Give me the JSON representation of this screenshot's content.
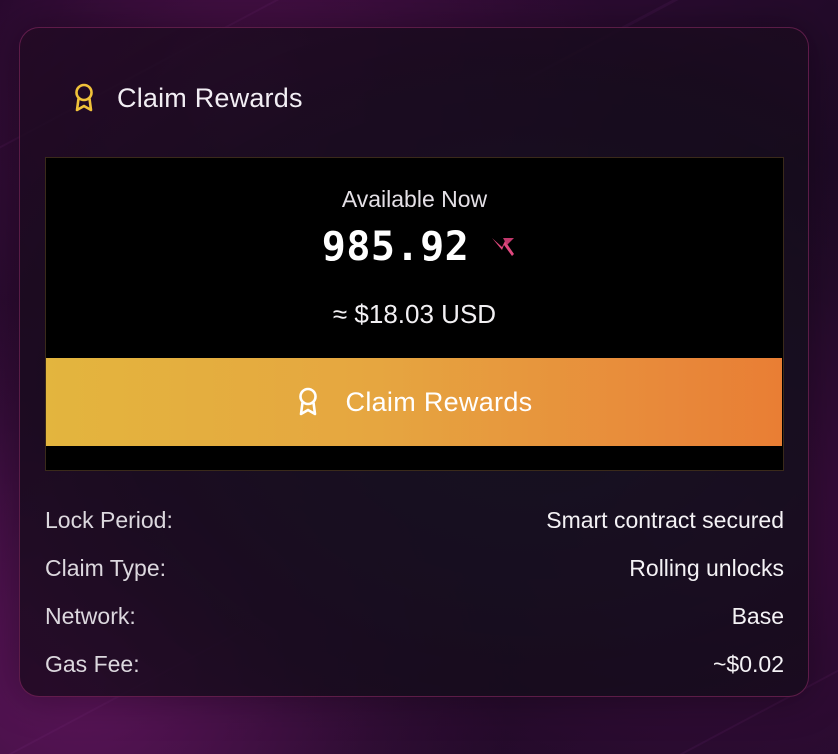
{
  "card": {
    "title": "Claim Rewards",
    "icon": "award-ribbon-icon"
  },
  "rewards": {
    "available_label": "Available Now",
    "amount": "985.92",
    "token_icon": "token-logo-icon",
    "usd_value": "≈ $18.03 USD"
  },
  "claim_button": {
    "label": "Claim Rewards",
    "icon": "award-ribbon-icon"
  },
  "details": [
    {
      "label": "Lock Period:",
      "value": "Smart contract secured"
    },
    {
      "label": "Claim Type:",
      "value": "Rolling unlocks"
    },
    {
      "label": "Network:",
      "value": "Base"
    },
    {
      "label": "Gas Fee:",
      "value": "~$0.02"
    }
  ],
  "colors": {
    "accent_start": "#e3b53e",
    "accent_end": "#e97e34",
    "icon_gold": "#f0c23a",
    "token_pink": "#e0487e",
    "card_border": "#aa3278"
  }
}
